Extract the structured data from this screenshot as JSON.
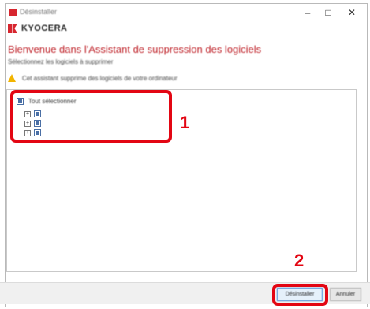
{
  "window": {
    "title": "Désinstaller",
    "minimize_glyph": "–",
    "maximize_glyph": "□",
    "close_glyph": "✕"
  },
  "brand": {
    "name": "KYOCERA",
    "color": "#d7262f"
  },
  "heading": "Bienvenue dans l'Assistant de suppression des logiciels",
  "subtext": "Sélectionnez les logiciels à supprimer",
  "info": {
    "icon": "warning-icon",
    "text": "Cet assistant supprime des logiciels de votre ordinateur"
  },
  "tree": {
    "root_label": "Tout sélectionner",
    "children": [
      {
        "expander": "+",
        "label": ""
      },
      {
        "expander": "+",
        "label": ""
      },
      {
        "expander": "+",
        "label": ""
      }
    ]
  },
  "callouts": {
    "one": "1",
    "two": "2",
    "color": "#e30613"
  },
  "buttons": {
    "primary": "Désinstaller",
    "secondary": "Annuler"
  }
}
